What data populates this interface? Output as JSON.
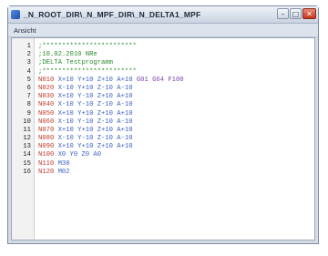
{
  "window": {
    "title": "_N_ROOT_DIR\\_N_MPF_DIR\\_N_DELTA1_MPF",
    "min_glyph": "–",
    "max_glyph": "□",
    "close_glyph": "✕"
  },
  "menu": {
    "items": [
      "Ansicht"
    ]
  },
  "colors": {
    "comment": "#2d8a2d",
    "block_number": "#c0392b",
    "address": "#3a5fc2",
    "gcode": "#7b3fb0"
  },
  "editor": {
    "lines": [
      {
        "num": "1",
        "tokens": [
          {
            "t": ";************************",
            "k": "comment"
          }
        ]
      },
      {
        "num": "2",
        "tokens": [
          {
            "t": ";10.02.2010 NRe",
            "k": "comment"
          }
        ]
      },
      {
        "num": "3",
        "tokens": [
          {
            "t": ";DELTA Testprogramm",
            "k": "comment"
          }
        ]
      },
      {
        "num": "4",
        "tokens": [
          {
            "t": ";************************",
            "k": "comment"
          }
        ]
      },
      {
        "num": "5",
        "tokens": [
          {
            "t": "N010",
            "k": "nr"
          },
          {
            "t": " X+10 Y+10 Z+10 A+10 ",
            "k": "addr"
          },
          {
            "t": "G01 G64 F100",
            "k": "g"
          }
        ]
      },
      {
        "num": "6",
        "tokens": [
          {
            "t": "N020",
            "k": "nr"
          },
          {
            "t": " X-10 Y+10 Z-10 A-10",
            "k": "addr"
          }
        ]
      },
      {
        "num": "7",
        "tokens": [
          {
            "t": "N030",
            "k": "nr"
          },
          {
            "t": " X+10 Y-10 Z+10 A+10",
            "k": "addr"
          }
        ]
      },
      {
        "num": "8",
        "tokens": [
          {
            "t": "N040",
            "k": "nr"
          },
          {
            "t": " X-10 Y-10 Z-10 A-10",
            "k": "addr"
          }
        ]
      },
      {
        "num": "9",
        "tokens": [
          {
            "t": "N050",
            "k": "nr"
          },
          {
            "t": " X+10 Y+10 Z+10 A+10",
            "k": "addr"
          }
        ]
      },
      {
        "num": "10",
        "tokens": [
          {
            "t": "N060",
            "k": "nr"
          },
          {
            "t": " X-10 Y-10 Z-10 A-10",
            "k": "addr"
          }
        ]
      },
      {
        "num": "11",
        "tokens": [
          {
            "t": "N070",
            "k": "nr"
          },
          {
            "t": " X+10 Y+10 Z+10 A+10",
            "k": "addr"
          }
        ]
      },
      {
        "num": "12",
        "tokens": [
          {
            "t": "N080",
            "k": "nr"
          },
          {
            "t": " X-10 Y-10 Z-10 A-10",
            "k": "addr"
          }
        ]
      },
      {
        "num": "13",
        "tokens": [
          {
            "t": "N090",
            "k": "nr"
          },
          {
            "t": " X+10 Y+10 Z+10 A+10",
            "k": "addr"
          }
        ]
      },
      {
        "num": "14",
        "tokens": [
          {
            "t": "N100",
            "k": "nr"
          },
          {
            "t": " X0 Y0 Z0 A0",
            "k": "addr"
          }
        ]
      },
      {
        "num": "15",
        "tokens": [
          {
            "t": "N110",
            "k": "nr"
          },
          {
            "t": " M30",
            "k": "m"
          }
        ]
      },
      {
        "num": "16",
        "tokens": [
          {
            "t": "N120",
            "k": "nr"
          },
          {
            "t": " M02",
            "k": "m"
          }
        ]
      }
    ]
  }
}
